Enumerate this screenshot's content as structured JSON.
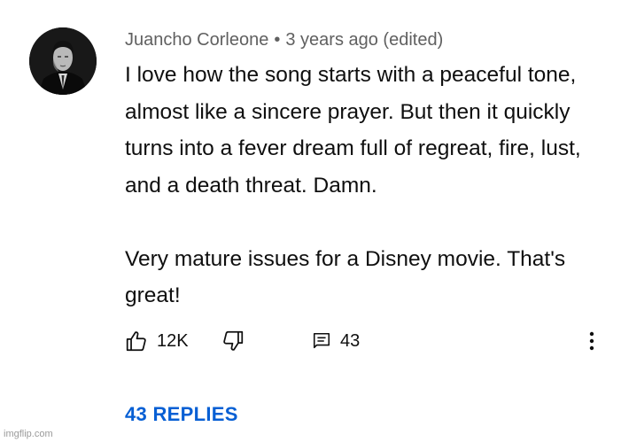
{
  "comment": {
    "author": "Juancho Corleone",
    "separator": "•",
    "timestamp": "3 years ago (edited)",
    "paragraphs": [
      "I love how the song starts with a peaceful tone, almost like a sincere prayer. But then it quickly turns into a fever dream full of regreat, fire, lust, and a death threat. Damn.",
      "Very mature issues for a Disney movie. That's great!"
    ],
    "like_count": "12K",
    "reply_count": "43",
    "replies_label": "43 REPLIES"
  },
  "icons": {
    "like": "thumbs-up-icon",
    "dislike": "thumbs-down-icon",
    "reply": "comment-icon",
    "more": "more-vertical-icon"
  },
  "colors": {
    "meta_text": "#606060",
    "body_text": "#0f0f0f",
    "replies_link": "#065fd4",
    "watermark": "#9a9a9a"
  },
  "watermark": "imgflip.com"
}
